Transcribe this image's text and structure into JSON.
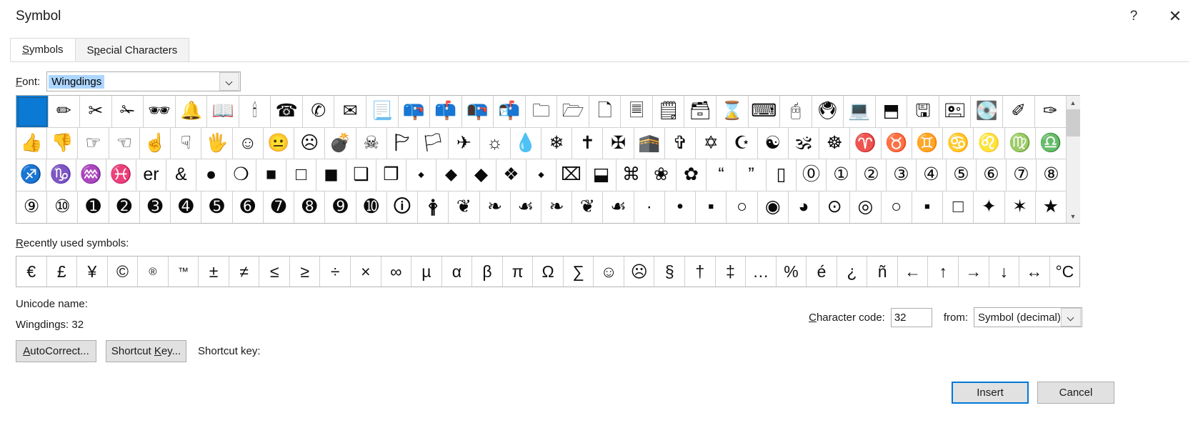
{
  "window": {
    "title": "Symbol",
    "help_label": "?",
    "close_label": "✕"
  },
  "tabs": [
    {
      "label": "Symbols",
      "accel": "S",
      "active": true
    },
    {
      "label": "Special Characters",
      "accel": "p",
      "active": false
    }
  ],
  "font": {
    "label": "Font:",
    "accel": "F",
    "value": "Wingdings",
    "selected": true,
    "dropdown_icon": "chevron-down-icon"
  },
  "grid": {
    "selected_index": 0,
    "rows": [
      [
        " ",
        "✏",
        "✂",
        "✁",
        "🕶",
        "🔔",
        "📖",
        "🕯",
        "☎",
        "✆",
        "✉",
        "📃",
        "📪",
        "📫",
        "📭",
        "📬",
        "🗀",
        "🗁",
        "🗋",
        "🗏",
        "🗒",
        "🗃",
        "⌛",
        "⌨",
        "🖰",
        "🖲",
        "💻",
        "⬒",
        "🖫",
        "🖭",
        "💽",
        "✐",
        "✑"
      ],
      [
        "👍",
        "👎",
        "☞",
        "☜",
        "☝",
        "☟",
        "🖐",
        "☺",
        "😐",
        "☹",
        "💣",
        "☠",
        "🏱",
        "🏳",
        "✈",
        "☼",
        "💧",
        "❄",
        "✝",
        "✠",
        "🕋",
        "✞",
        "✡",
        "☪",
        "☯",
        "🕉",
        "☸",
        "♈",
        "♉",
        "♊",
        "♋",
        "♌",
        "♍",
        "♎"
      ],
      [
        "♐",
        "♑",
        "♒",
        "♓",
        "er",
        "&",
        "●",
        "❍",
        "■",
        "□",
        "◼",
        "❑",
        "❒",
        "⬩",
        "⬥",
        "◆",
        "❖",
        "⬩",
        "⌧",
        "⬓",
        "⌘",
        "❀",
        "✿",
        "“",
        "”",
        "▯",
        "⓪",
        "①",
        "②",
        "③",
        "④",
        "⑤",
        "⑥",
        "⑦",
        "⑧"
      ],
      [
        "⑨",
        "⑩",
        "➊",
        "➋",
        "➌",
        "➍",
        "➎",
        "➏",
        "➐",
        "➑",
        "➒",
        "➓",
        "🛈",
        "🛉",
        "❦",
        "❧",
        "☙",
        "❧",
        "❦",
        "☙",
        "·",
        "•",
        "▪",
        "○",
        "◉",
        "◕",
        "⊙",
        "◎",
        "○",
        "▪",
        "□",
        "✦",
        "✶",
        "★"
      ]
    ],
    "scrollbar": {
      "up_label": "▲",
      "down_label": "▼"
    }
  },
  "recent": {
    "label": "Recently used symbols:",
    "accel": "R",
    "symbols": [
      {
        "char": "€",
        "small": false
      },
      {
        "char": "£",
        "small": false
      },
      {
        "char": "¥",
        "small": false
      },
      {
        "char": "©",
        "small": false
      },
      {
        "char": "®",
        "small": true
      },
      {
        "char": "™",
        "small": true
      },
      {
        "char": "±",
        "small": false
      },
      {
        "char": "≠",
        "small": false
      },
      {
        "char": "≤",
        "small": false
      },
      {
        "char": "≥",
        "small": false
      },
      {
        "char": "÷",
        "small": false
      },
      {
        "char": "×",
        "small": false
      },
      {
        "char": "∞",
        "small": false
      },
      {
        "char": "µ",
        "small": false
      },
      {
        "char": "α",
        "small": false
      },
      {
        "char": "β",
        "small": false
      },
      {
        "char": "π",
        "small": false
      },
      {
        "char": "Ω",
        "small": false
      },
      {
        "char": "∑",
        "small": false
      },
      {
        "char": "☺",
        "small": false
      },
      {
        "char": "☹",
        "small": false
      },
      {
        "char": "§",
        "small": false
      },
      {
        "char": "†",
        "small": false
      },
      {
        "char": "‡",
        "small": false
      },
      {
        "char": "…",
        "small": false
      },
      {
        "char": "%",
        "small": false
      },
      {
        "char": "é",
        "small": false
      },
      {
        "char": "¿",
        "small": false
      },
      {
        "char": "ñ",
        "small": false
      },
      {
        "char": "←",
        "small": false
      },
      {
        "char": "↑",
        "small": false
      },
      {
        "char": "→",
        "small": false
      },
      {
        "char": "↓",
        "small": false
      },
      {
        "char": "↔",
        "small": false
      },
      {
        "char": "°C",
        "small": false
      }
    ]
  },
  "info": {
    "unicode_name_label": "Unicode name:",
    "unicode_name_value": "Wingdings: 32"
  },
  "charcode": {
    "label": "Character code:",
    "accel": "C",
    "value": "32",
    "from_label": "from:",
    "from_value": "Symbol (decimal)",
    "dropdown_icon": "chevron-down-icon"
  },
  "actions": {
    "autocorrect": "AutoCorrect...",
    "autocorrect_accel": "A",
    "shortcut_key_button": "Shortcut Key...",
    "shortcut_key_accel": "K",
    "shortcut_key_label": "Shortcut key:",
    "insert": "Insert",
    "cancel": "Cancel"
  },
  "colors": {
    "selection_blue": "#0a7ad4",
    "highlight_blue": "#add6ff",
    "accent_border": "#0078d7",
    "dialog_bg": "#ffffff"
  }
}
